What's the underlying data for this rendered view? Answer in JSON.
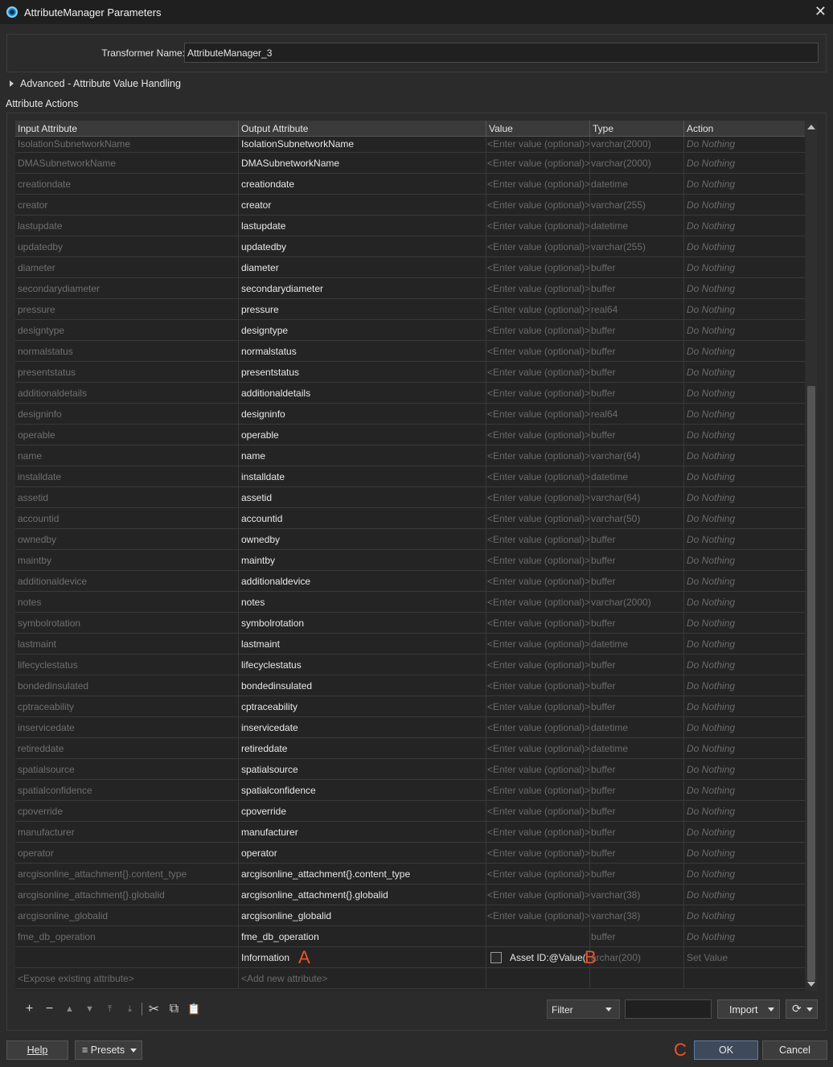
{
  "window": {
    "title": "AttributeManager Parameters",
    "close": "✕"
  },
  "name_field": {
    "label": "Transformer Name:",
    "value": "AttributeManager_3"
  },
  "advanced_label": "Advanced - Attribute Value Handling",
  "section_label": "Attribute Actions",
  "columns": [
    "Input Attribute",
    "Output Attribute",
    "Value",
    "Type",
    "Action"
  ],
  "rows": [
    {
      "in": "IsolationSubnetworkName",
      "out": "IsolationSubnetworkName",
      "val": "<Enter value (optional)>",
      "type": "varchar(2000)",
      "action": "Do Nothing"
    },
    {
      "in": "DMASubnetworkName",
      "out": "DMASubnetworkName",
      "val": "<Enter value (optional)>",
      "type": "varchar(2000)",
      "action": "Do Nothing"
    },
    {
      "in": "creationdate",
      "out": "creationdate",
      "val": "<Enter value (optional)>",
      "type": "datetime",
      "action": "Do Nothing"
    },
    {
      "in": "creator",
      "out": "creator",
      "val": "<Enter value (optional)>",
      "type": "varchar(255)",
      "action": "Do Nothing"
    },
    {
      "in": "lastupdate",
      "out": "lastupdate",
      "val": "<Enter value (optional)>",
      "type": "datetime",
      "action": "Do Nothing"
    },
    {
      "in": "updatedby",
      "out": "updatedby",
      "val": "<Enter value (optional)>",
      "type": "varchar(255)",
      "action": "Do Nothing"
    },
    {
      "in": "diameter",
      "out": "diameter",
      "val": "<Enter value (optional)>",
      "type": "buffer",
      "action": "Do Nothing"
    },
    {
      "in": "secondarydiameter",
      "out": "secondarydiameter",
      "val": "<Enter value (optional)>",
      "type": "buffer",
      "action": "Do Nothing"
    },
    {
      "in": "pressure",
      "out": "pressure",
      "val": "<Enter value (optional)>",
      "type": "real64",
      "action": "Do Nothing"
    },
    {
      "in": "designtype",
      "out": "designtype",
      "val": "<Enter value (optional)>",
      "type": "buffer",
      "action": "Do Nothing"
    },
    {
      "in": "normalstatus",
      "out": "normalstatus",
      "val": "<Enter value (optional)>",
      "type": "buffer",
      "action": "Do Nothing"
    },
    {
      "in": "presentstatus",
      "out": "presentstatus",
      "val": "<Enter value (optional)>",
      "type": "buffer",
      "action": "Do Nothing"
    },
    {
      "in": "additionaldetails",
      "out": "additionaldetails",
      "val": "<Enter value (optional)>",
      "type": "buffer",
      "action": "Do Nothing"
    },
    {
      "in": "designinfo",
      "out": "designinfo",
      "val": "<Enter value (optional)>",
      "type": "real64",
      "action": "Do Nothing"
    },
    {
      "in": "operable",
      "out": "operable",
      "val": "<Enter value (optional)>",
      "type": "buffer",
      "action": "Do Nothing"
    },
    {
      "in": "name",
      "out": "name",
      "val": "<Enter value (optional)>",
      "type": "varchar(64)",
      "action": "Do Nothing"
    },
    {
      "in": "installdate",
      "out": "installdate",
      "val": "<Enter value (optional)>",
      "type": "datetime",
      "action": "Do Nothing"
    },
    {
      "in": "assetid",
      "out": "assetid",
      "val": "<Enter value (optional)>",
      "type": "varchar(64)",
      "action": "Do Nothing"
    },
    {
      "in": "accountid",
      "out": "accountid",
      "val": "<Enter value (optional)>",
      "type": "varchar(50)",
      "action": "Do Nothing"
    },
    {
      "in": "ownedby",
      "out": "ownedby",
      "val": "<Enter value (optional)>",
      "type": "buffer",
      "action": "Do Nothing"
    },
    {
      "in": "maintby",
      "out": "maintby",
      "val": "<Enter value (optional)>",
      "type": "buffer",
      "action": "Do Nothing"
    },
    {
      "in": "additionaldevice",
      "out": "additionaldevice",
      "val": "<Enter value (optional)>",
      "type": "buffer",
      "action": "Do Nothing"
    },
    {
      "in": "notes",
      "out": "notes",
      "val": "<Enter value (optional)>",
      "type": "varchar(2000)",
      "action": "Do Nothing"
    },
    {
      "in": "symbolrotation",
      "out": "symbolrotation",
      "val": "<Enter value (optional)>",
      "type": "buffer",
      "action": "Do Nothing"
    },
    {
      "in": "lastmaint",
      "out": "lastmaint",
      "val": "<Enter value (optional)>",
      "type": "datetime",
      "action": "Do Nothing"
    },
    {
      "in": "lifecyclestatus",
      "out": "lifecyclestatus",
      "val": "<Enter value (optional)>",
      "type": "buffer",
      "action": "Do Nothing"
    },
    {
      "in": "bondedinsulated",
      "out": "bondedinsulated",
      "val": "<Enter value (optional)>",
      "type": "buffer",
      "action": "Do Nothing"
    },
    {
      "in": "cptraceability",
      "out": "cptraceability",
      "val": "<Enter value (optional)>",
      "type": "buffer",
      "action": "Do Nothing"
    },
    {
      "in": "inservicedate",
      "out": "inservicedate",
      "val": "<Enter value (optional)>",
      "type": "datetime",
      "action": "Do Nothing"
    },
    {
      "in": "retireddate",
      "out": "retireddate",
      "val": "<Enter value (optional)>",
      "type": "datetime",
      "action": "Do Nothing"
    },
    {
      "in": "spatialsource",
      "out": "spatialsource",
      "val": "<Enter value (optional)>",
      "type": "buffer",
      "action": "Do Nothing"
    },
    {
      "in": "spatialconfidence",
      "out": "spatialconfidence",
      "val": "<Enter value (optional)>",
      "type": "buffer",
      "action": "Do Nothing"
    },
    {
      "in": "cpoverride",
      "out": "cpoverride",
      "val": "<Enter value (optional)>",
      "type": "buffer",
      "action": "Do Nothing"
    },
    {
      "in": "manufacturer",
      "out": "manufacturer",
      "val": "<Enter value (optional)>",
      "type": "buffer",
      "action": "Do Nothing"
    },
    {
      "in": "operator",
      "out": "operator",
      "val": "<Enter value (optional)>",
      "type": "buffer",
      "action": "Do Nothing"
    },
    {
      "in": "arcgisonline_attachment{}.content_type",
      "out": "arcgisonline_attachment{}.content_type",
      "val": "<Enter value (optional)>",
      "type": "buffer",
      "action": "Do Nothing"
    },
    {
      "in": "arcgisonline_attachment{}.globalid",
      "out": "arcgisonline_attachment{}.globalid",
      "val": "<Enter value (optional)>",
      "type": "varchar(38)",
      "action": "Do Nothing"
    },
    {
      "in": "arcgisonline_globalid",
      "out": "arcgisonline_globalid",
      "val": "<Enter value (optional)>",
      "type": "varchar(38)",
      "action": "Do Nothing"
    },
    {
      "in": "fme_db_operation",
      "out": "fme_db_operation",
      "val": "",
      "type": "buffer",
      "action": "Do Nothing"
    }
  ],
  "new_row": {
    "in": "",
    "out": "Information",
    "val": "Asset ID:@Value(...",
    "type": "archar(200)",
    "action": "Set Value"
  },
  "add_row": {
    "in": "<Expose existing attribute>",
    "out": "<Add new attribute>"
  },
  "markers": {
    "a": "A",
    "b": "B",
    "c": "C"
  },
  "toolbar": {
    "add": "+",
    "remove": "−",
    "up": "▲",
    "down": "▼",
    "top": "⤒",
    "bottom": "⤓",
    "cut": "✂",
    "copy": "⧉",
    "paste": "📋"
  },
  "filter": {
    "label": "Filter"
  },
  "import_label": "Import",
  "refresh": "⟳",
  "buttons": {
    "help": "Help",
    "presets": "Presets",
    "ok": "OK",
    "cancel": "Cancel"
  },
  "icons": {
    "presets": "≡"
  },
  "colors": {
    "accent": "#1e88c8",
    "marker": "#e8562a"
  }
}
